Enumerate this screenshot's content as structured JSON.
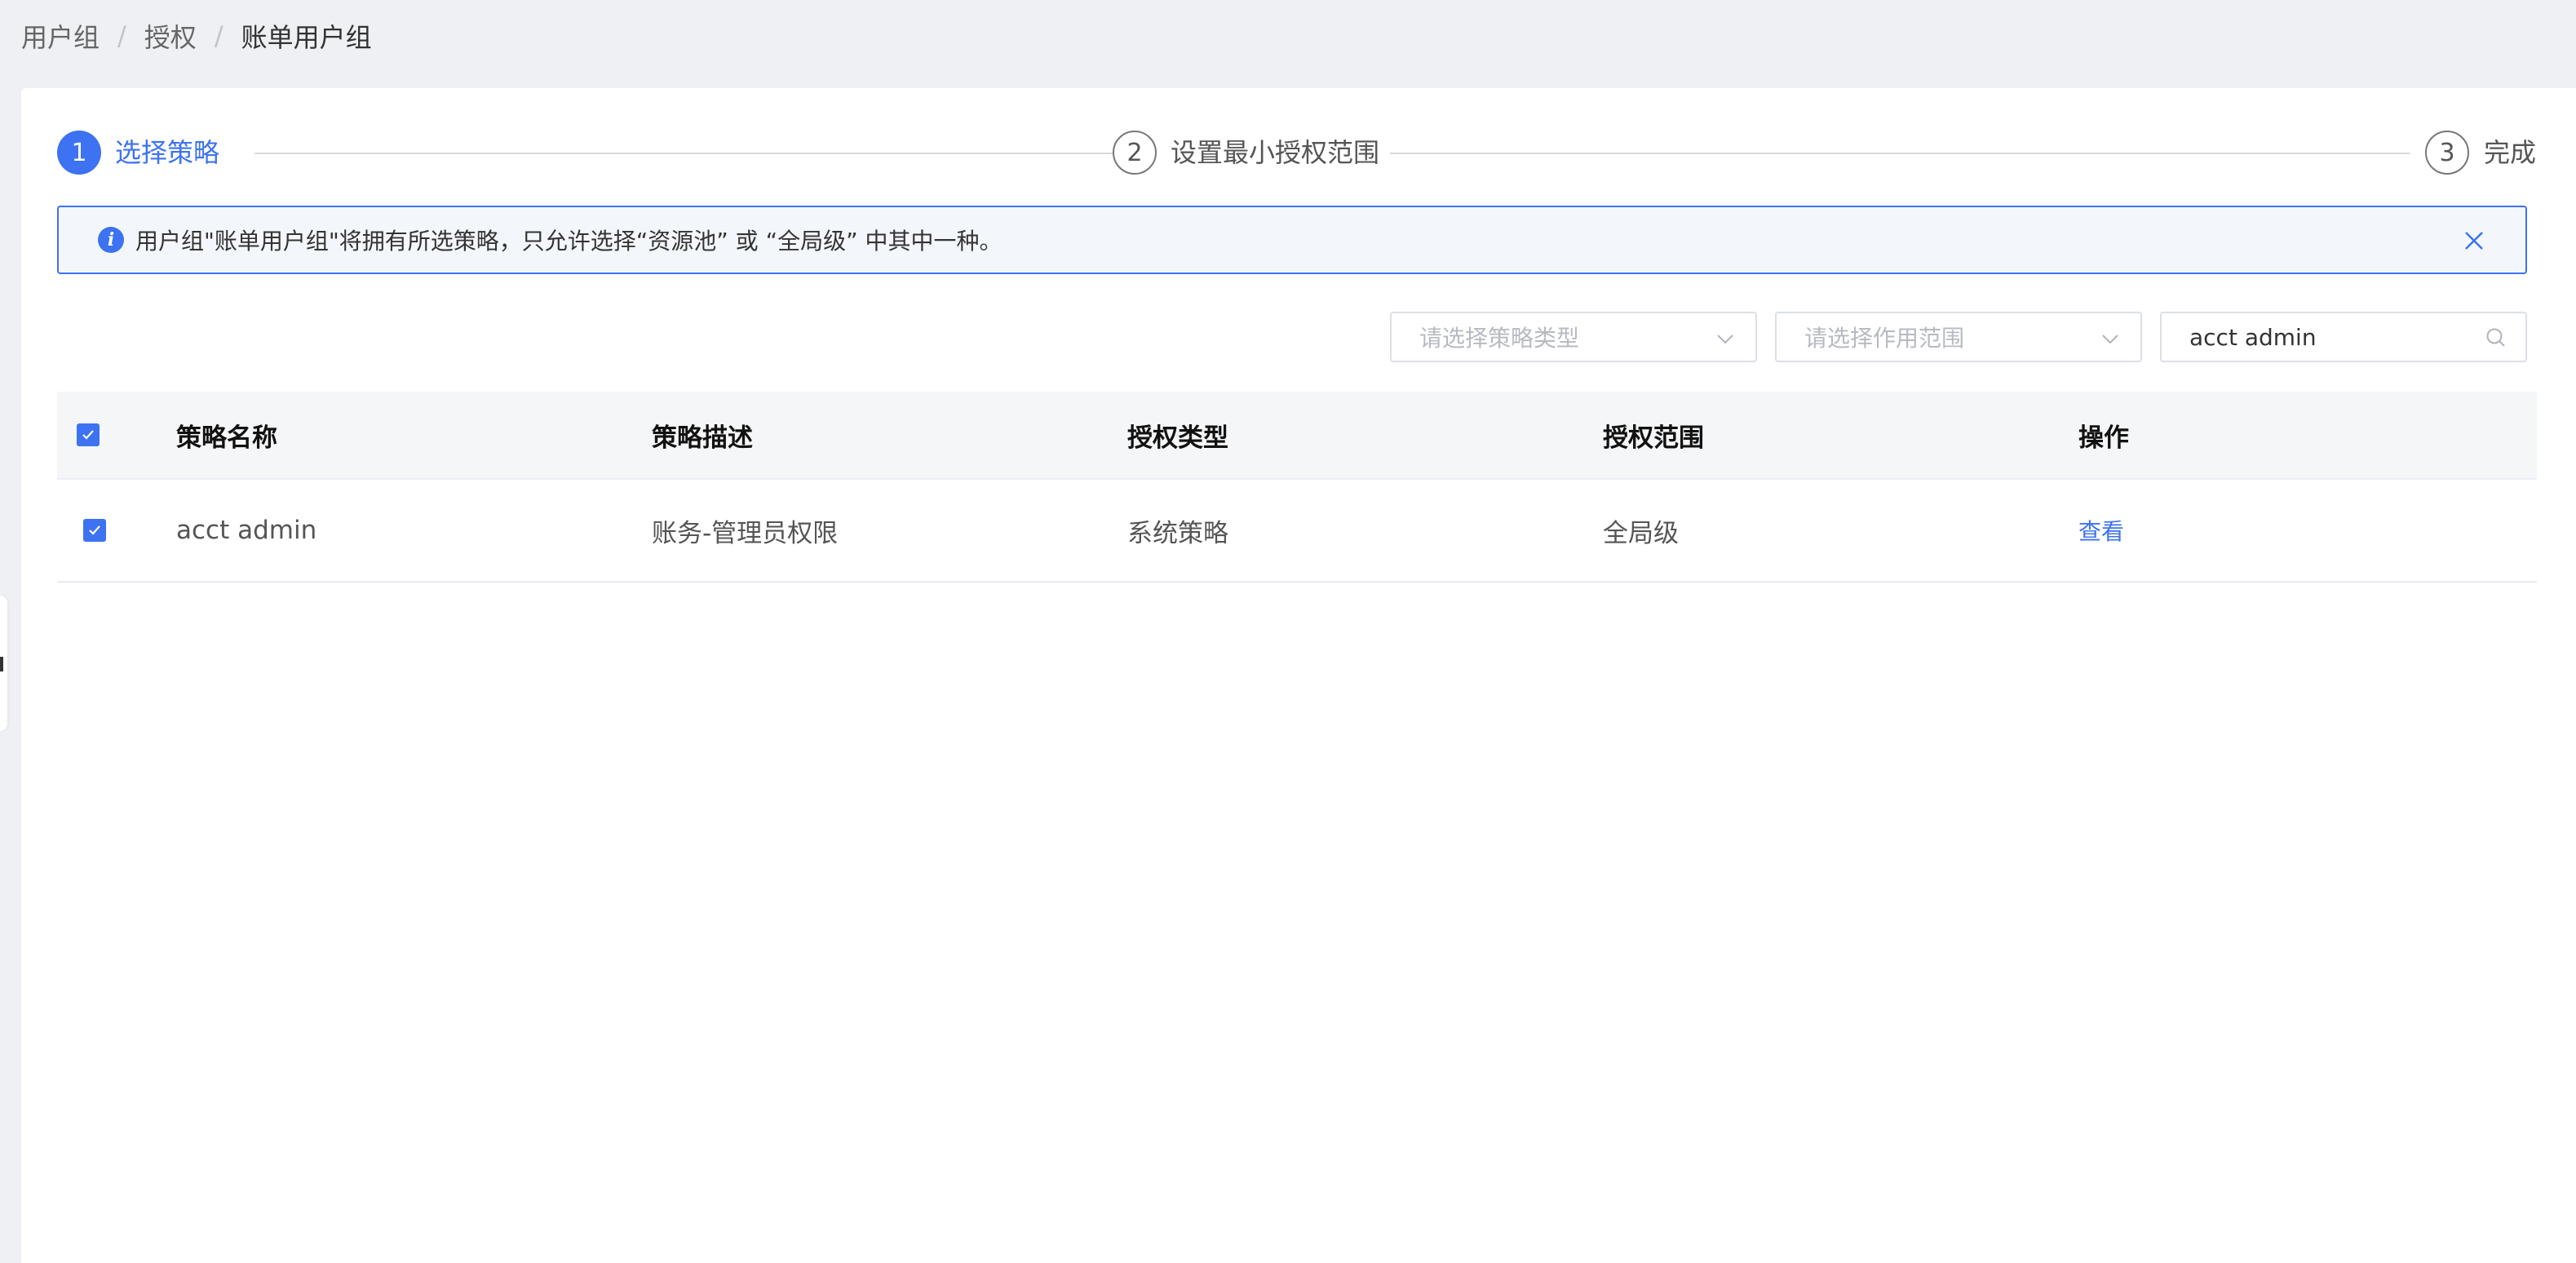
{
  "breadcrumb": {
    "items": [
      "用户组",
      "授权",
      "账单用户组"
    ],
    "separator": "/"
  },
  "steps": [
    {
      "number": "1",
      "label": "选择策略",
      "state": "active"
    },
    {
      "number": "2",
      "label": "设置最小授权范围",
      "state": "pending"
    },
    {
      "number": "3",
      "label": "完成",
      "state": "pending"
    }
  ],
  "alert": {
    "text": "用户组\"账单用户组\"将拥有所选策略，只允许选择“资源池” 或 “全局级” 中其中一种。",
    "icon": "info-icon"
  },
  "filters": {
    "policy_type_placeholder": "请选择策略类型",
    "scope_placeholder": "请选择作用范围",
    "search_value": "acct admin"
  },
  "table": {
    "columns": [
      "策略名称",
      "策略描述",
      "授权类型",
      "授权范围",
      "操作"
    ],
    "rows": [
      {
        "name": "acct admin",
        "description": "账务-管理员权限",
        "auth_type": "系统策略",
        "scope": "全局级",
        "action": "查看",
        "checked": true
      }
    ],
    "select_all_checked": true
  },
  "colors": {
    "accent": "#3d72f2",
    "background": "#eef0f3",
    "header_bg": "#f5f6f8",
    "alert_bg": "#f3f7fb"
  }
}
